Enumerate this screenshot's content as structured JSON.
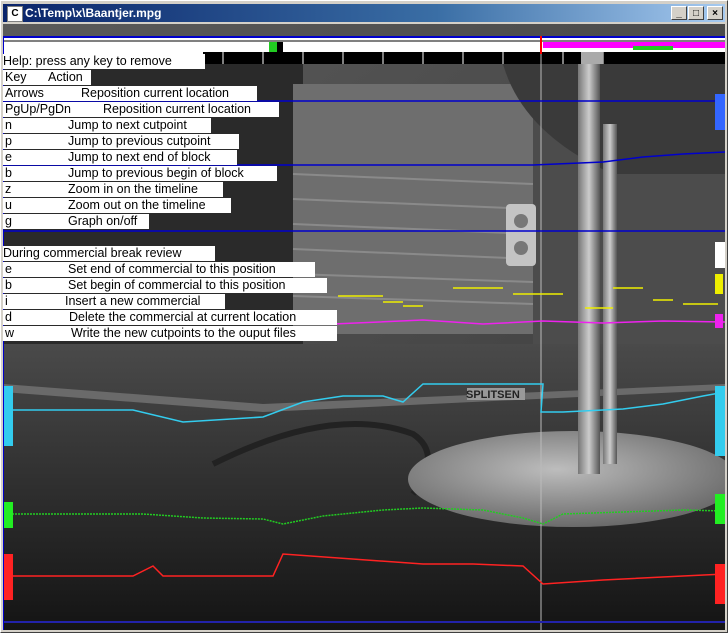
{
  "window": {
    "title": "C:\\Temp\\x\\Baantjer.mpg",
    "app_icon": "C",
    "min_glyph": "_",
    "max_glyph": "□",
    "close_glyph": "×"
  },
  "help": {
    "header": "Help: press any key to remove",
    "col_key": "Key",
    "col_action": "Action",
    "rows": [
      {
        "key": "Arrows",
        "action": "Reposition current location"
      },
      {
        "key": "PgUp/PgDn",
        "action": "Reposition current location"
      },
      {
        "key": "n",
        "action": "Jump to next cutpoint"
      },
      {
        "key": "p",
        "action": "Jump to previous cutpoint"
      },
      {
        "key": "e",
        "action": "Jump to next end of block"
      },
      {
        "key": "b",
        "action": "Jump to previous begin of block"
      },
      {
        "key": "z",
        "action": "Zoom in on the timeline"
      },
      {
        "key": "u",
        "action": "Zoom out on the timeline"
      },
      {
        "key": "g",
        "action": "Graph on/off"
      }
    ],
    "section_title": "During commercial break review",
    "review_rows": [
      {
        "key": "e",
        "action": "Set end of commercial to this position"
      },
      {
        "key": "b",
        "action": "Set begin of commercial to this position"
      },
      {
        "key": "i",
        "action": "Insert a new commercial"
      },
      {
        "key": "d",
        "action": "Delete the commercial at current location"
      },
      {
        "key": "w",
        "action": "Write the new cutpoints to the ouput files"
      }
    ]
  },
  "video_overlay_text": "SPLITSEN",
  "colors": {
    "title_start": "#0a246a",
    "title_end": "#a6caf0",
    "graph_blue": "#0000cc",
    "graph_cyan": "#33ccee",
    "graph_green": "#22cc22",
    "graph_red": "#ff2222",
    "graph_yellow": "#eeee00",
    "graph_magenta": "#ee22ee",
    "timeline_magenta": "#ff00ff"
  }
}
